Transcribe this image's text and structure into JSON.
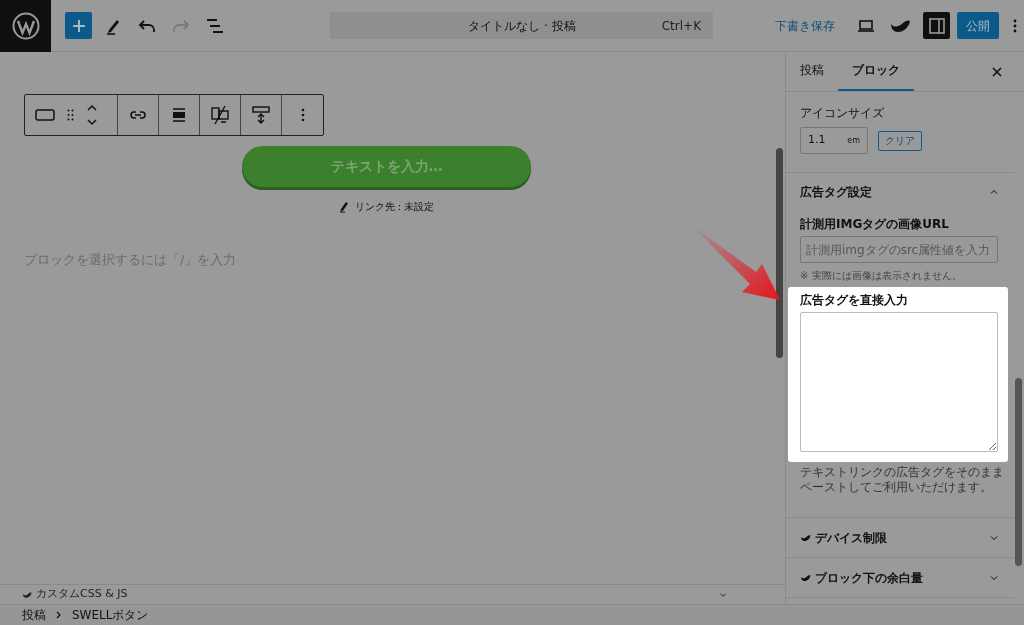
{
  "header": {
    "title": "タイトルなし · 投稿",
    "shortcut": "Ctrl+K",
    "save_draft": "下書き保存",
    "publish": "公開",
    "sidebar_toggle_on": true
  },
  "canvas": {
    "button_text": "テキストを入力…",
    "link_label": "リンク先 : 未設定",
    "placeholder": "ブロックを選択するには「/」を入力",
    "bottom_panel_title": "カスタムCSS & JS"
  },
  "sidebar": {
    "tabs": [
      {
        "label": "投稿",
        "selected": false
      },
      {
        "label": "ブロック",
        "selected": true
      }
    ],
    "icon_size": {
      "label": "アイコンサイズ",
      "value": "1.1",
      "unit": "em",
      "clear": "クリア"
    },
    "ad_tag": {
      "title": "広告タグ設定",
      "expanded": true,
      "img_label": "計測用IMGタグの画像URL",
      "img_placeholder": "計測用imgタグのsrc属性値を入力",
      "img_note": "※ 実際には画像は表示されません。",
      "direct_label": "広告タグを直接入力",
      "direct_help": "テキストリンクの広告タグをそのままペーストしてご利用いただけます。"
    },
    "panels": [
      {
        "title": "デバイス制限",
        "expanded": false
      },
      {
        "title": "ブロック下の余白量",
        "expanded": false
      }
    ]
  },
  "breadcrumb": [
    "投稿",
    "SWELLボタン"
  ]
}
